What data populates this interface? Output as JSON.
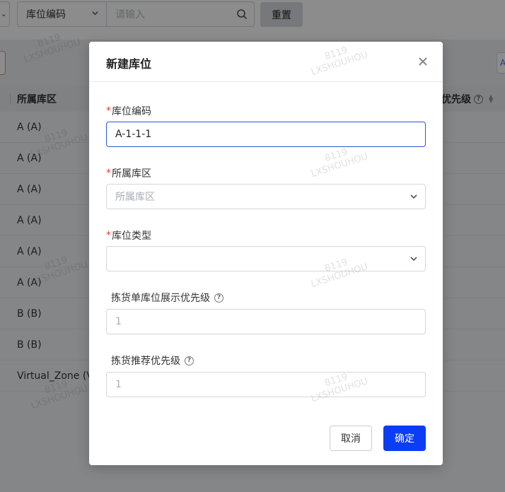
{
  "filter": {
    "field_select_value": "库位编码",
    "search_placeholder": "请输入",
    "reset_label": "重置"
  },
  "table": {
    "col_zone_header": "所属库区",
    "col_priority_header": "优先级",
    "rows": [
      "A (A)",
      "A (A)",
      "A (A)",
      "A (A)",
      "A (A)",
      "A (A)",
      "B (B)",
      "B (B)",
      "Virtual_Zone (Vir"
    ]
  },
  "watermark": {
    "line1": "8119",
    "line2": "LXSHOUHOU"
  },
  "modal": {
    "title": "新建库位",
    "required_mark": "*",
    "fields": {
      "location_code": {
        "label": "库位编码",
        "value": "A-1-1-1"
      },
      "zone": {
        "label": "所属库区",
        "placeholder": "所属库区"
      },
      "location_type": {
        "label": "库位类型",
        "value": ""
      },
      "display_priority": {
        "label": "拣货单库位展示优先级",
        "placeholder": "1"
      },
      "recommend_priority": {
        "label": "拣货推荐优先级",
        "placeholder": "1"
      }
    },
    "cancel_label": "取消",
    "ok_label": "确定"
  },
  "colors": {
    "primary": "#0b3df5",
    "focus_border": "#2b58d4",
    "required": "#e0403b",
    "mask": "rgba(0,0,0,0.45)"
  }
}
